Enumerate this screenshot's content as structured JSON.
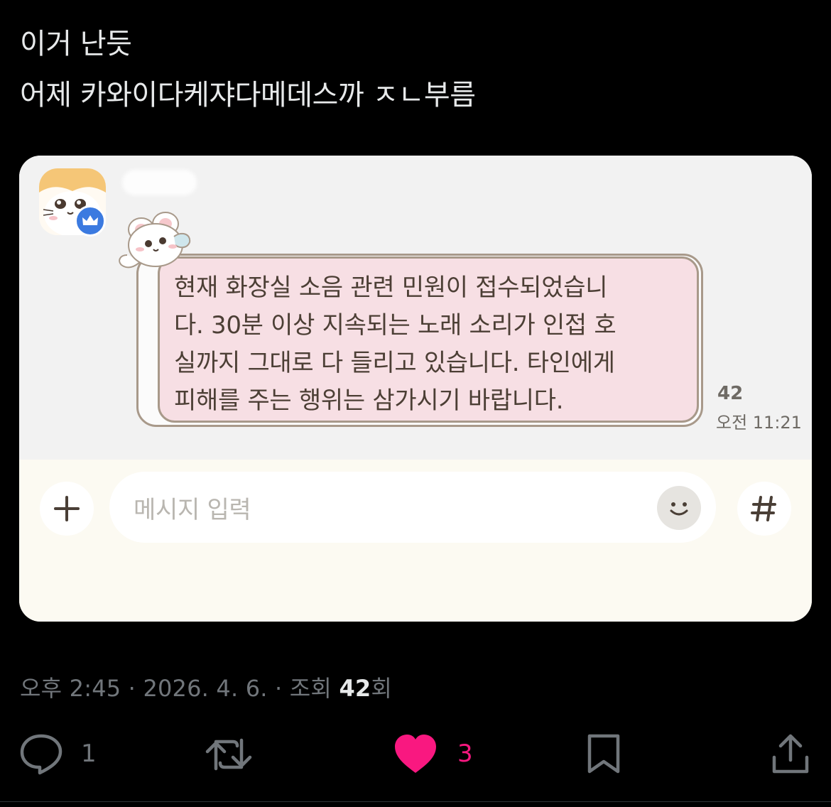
{
  "post": {
    "text_lines": [
      "이거 난듯",
      "어제 카와이다케쟈다메데스까 ㅈㄴ부름"
    ]
  },
  "chat": {
    "message_lines": [
      "현재 화장실 소음 관련 민원이 접수되었습니",
      "다. 30분 이상 지속되는 노래 소리가 인접 호",
      "실까지 그대로 다 들리고 있습니다. 타인에게",
      "피해를 주는 행위는 삼가시기 바랍니다."
    ],
    "read_count": "42",
    "time": "오전 11:21",
    "input_placeholder": "메시지 입력",
    "plus_icon": "plus-icon",
    "emoji_icon": "smiley-icon",
    "hash_icon": "hashtag-icon",
    "badge_icon": "crown-icon",
    "bubble_color": "#f7dfe4",
    "bubble_border_color": "#a8998a"
  },
  "meta": {
    "time": "오후 2:45",
    "sep1": " · ",
    "date": "2026. 4. 6.",
    "sep2": " · ",
    "views_label": "조회 ",
    "views_count": "42",
    "views_suffix": "회"
  },
  "actions": {
    "reply_count": "1",
    "repost_count": "",
    "like_count": "3",
    "like_color": "#f91880",
    "icon_color": "#71767b"
  }
}
